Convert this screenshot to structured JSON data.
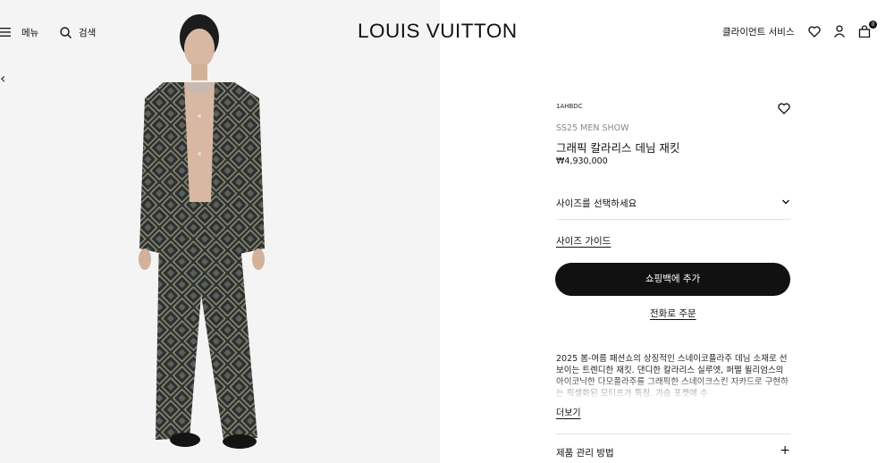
{
  "header": {
    "menu_label": "메뉴",
    "search_label": "검색",
    "logo": "LOUIS VUITTON",
    "client_service": "클라이언트 서비스",
    "bag_count": "0",
    "icons": [
      "menu-icon",
      "search-icon",
      "heart-icon",
      "user-icon",
      "bag-icon"
    ]
  },
  "gallery": {
    "prev_arrow": "‹",
    "colors": {
      "background": "#f4f4f4",
      "jacket": "#2b3034",
      "pattern": "#8f8a6e"
    }
  },
  "product": {
    "sku": "1AHBDC",
    "collection": "SS25 MEN SHOW",
    "name": "그래픽 칼라리스 데님 재킷",
    "price": "₩4,930,000",
    "size_prompt": "사이즈를 선택하세요",
    "size_guide": "사이즈 가이드",
    "add_to_bag": "쇼핑백에 추가",
    "phone_order": "전화로 주문",
    "description": "2025 봄-여름 패션쇼의 상징적인 스네이코플라주 데님 소재로 선보이는 트렌디한 재킷. 댄디한 칼라리스 실루엣, 퍼펠 윌리엄스의 아이코닉한 다모플라주를 그래픽한 스네이크스킨 자카드로 구현하는 픽셀화된 모티프가 특징. 가슴 포켓에 수",
    "more": "더보기",
    "care_label": "제품 관리 방법",
    "care_toggle": "+"
  },
  "colors": {
    "accent": "#111111",
    "divider": "#e3e3e3",
    "muted_text": "#888888"
  }
}
